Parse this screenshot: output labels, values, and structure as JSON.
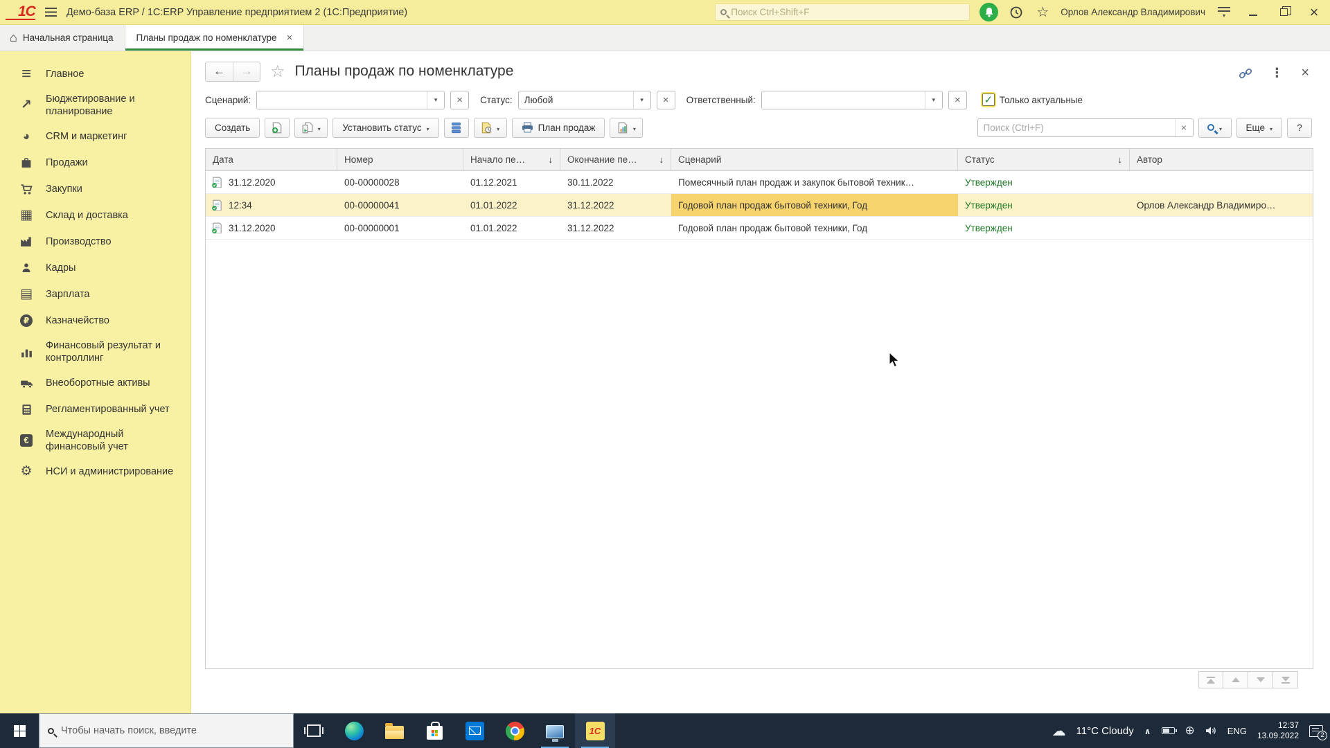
{
  "window": {
    "logo_text": "1С",
    "title": "Демо-база ERP / 1С:ERP Управление предприятием 2  (1С:Предприятие)",
    "search_placeholder": "Поиск Ctrl+Shift+F",
    "user_name": "Орлов Александр Владимирович"
  },
  "tabs": {
    "home": "Начальная страница",
    "active": "Планы продаж по номенклатуре"
  },
  "sidebar": {
    "items": [
      {
        "label": "Главное"
      },
      {
        "label": "Бюджетирование и планирование"
      },
      {
        "label": "CRM и маркетинг"
      },
      {
        "label": "Продажи"
      },
      {
        "label": "Закупки"
      },
      {
        "label": "Склад и доставка"
      },
      {
        "label": "Производство"
      },
      {
        "label": "Кадры"
      },
      {
        "label": "Зарплата"
      },
      {
        "label": "Казначейство"
      },
      {
        "label": "Финансовый результат и контроллинг"
      },
      {
        "label": "Внеоборотные активы"
      },
      {
        "label": "Регламентированный учет"
      },
      {
        "label": "Международный финансовый учет"
      },
      {
        "label": "НСИ и администрирование"
      }
    ]
  },
  "page": {
    "title": "Планы продаж по номенклатуре",
    "filters": {
      "scenario_label": "Сценарий:",
      "scenario_value": "",
      "status_label": "Статус:",
      "status_value": "Любой",
      "responsible_label": "Ответственный:",
      "responsible_value": "",
      "only_actual_label": "Только актуальные"
    },
    "toolbar": {
      "create": "Создать",
      "set_status": "Установить статус",
      "plan": "План продаж",
      "search_placeholder": "Поиск (Ctrl+F)",
      "more": "Еще",
      "help": "?"
    },
    "table": {
      "columns": [
        "Дата",
        "Номер",
        "Начало пе…",
        "Окончание пе…",
        "Сценарий",
        "Статус",
        "Автор"
      ],
      "rows": [
        {
          "date": "31.12.2020",
          "number": "00-00000028",
          "start": "01.12.2021",
          "end": "30.11.2022",
          "scenario": "Помесячный план продаж и закупок бытовой техник…",
          "status": "Утвержден",
          "author": ""
        },
        {
          "date": "12:34",
          "number": "00-00000041",
          "start": "01.01.2022",
          "end": "31.12.2022",
          "scenario": "Годовой план продаж бытовой техники, Год",
          "status": "Утвержден",
          "author": "Орлов Александр Владимиро…"
        },
        {
          "date": "31.12.2020",
          "number": "00-00000001",
          "start": "01.01.2022",
          "end": "31.12.2022",
          "scenario": "Годовой план продаж бытовой техники, Год",
          "status": "Утвержден",
          "author": ""
        }
      ]
    }
  },
  "taskbar": {
    "search_placeholder": "Чтобы начать поиск, введите",
    "weather": "11°C Cloudy",
    "language": "ENG",
    "time": "12:37",
    "date": "13.09.2022",
    "notification_count": "2"
  },
  "colors": {
    "titlebar_bg": "#f5ed9b",
    "sidebar_bg": "#f8f1a4",
    "active_tab_accent": "#338a3d",
    "status_green": "#1f7a25",
    "selected_row_bg": "#fcf2c8",
    "focused_cell_bg": "#f6d36d",
    "taskbar_bg": "#1d2a39",
    "notification_bell_bg": "#2eae49"
  }
}
